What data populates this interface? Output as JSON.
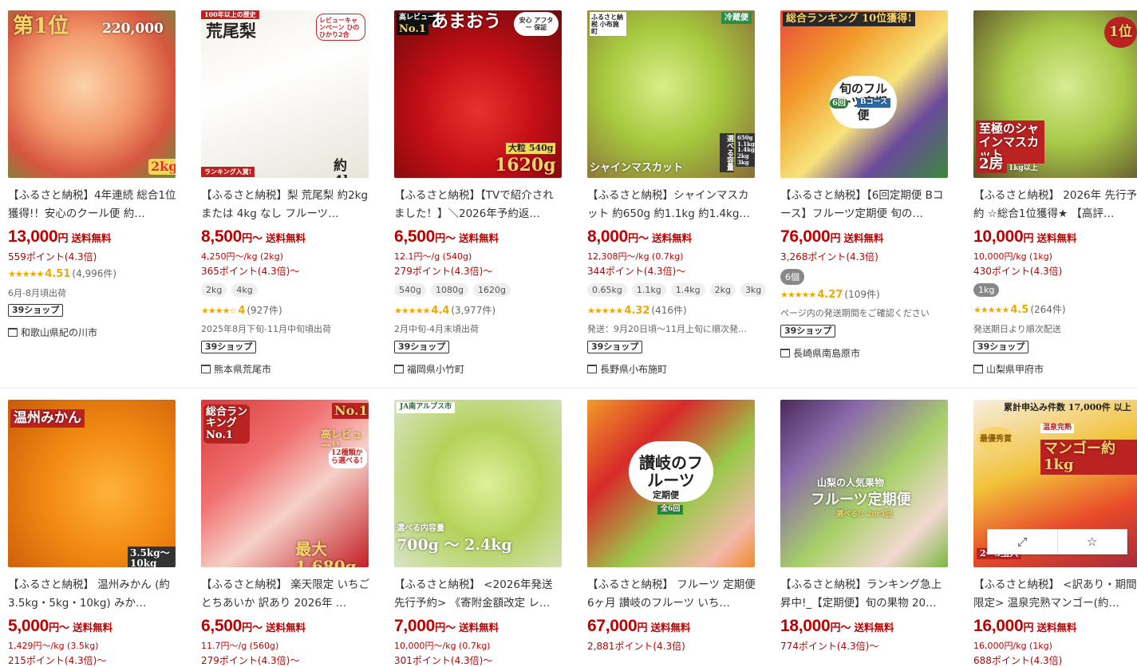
{
  "row1": [
    {
      "image_text": [
        "第1位",
        "220,000",
        "2kg"
      ],
      "title": "【ふるさと納税】4年連続 総合1位獲得!！安心のクール便 約…",
      "price": "13,000",
      "unit": "円",
      "ship": "送料無料",
      "sub1": "559ポイント(4.3倍)",
      "rating": "4.51",
      "reviews": "(4,996件)",
      "note": "6月-8月頃出荷",
      "tag": "39ショップ",
      "location": "和歌山県紀の川市"
    },
    {
      "image_text": [
        "100年以上の歴史",
        "荒尾梨",
        "レビューキャンペーン ひのひかり2合",
        "ランキング入賞!",
        "約4kg"
      ],
      "title": "【ふるさと納税】梨 荒尾梨 約2kg または 4kg なし フルーツ…",
      "price": "8,500",
      "unit": "円〜",
      "ship": "送料無料",
      "sub1": "4,250円〜/kg (2kg)",
      "sub2": "365ポイント(4.3倍)〜",
      "chips": [
        "2kg",
        "4kg"
      ],
      "rating": "4",
      "reviews": "(927件)",
      "note": "2025年8月下旬-11月中旬頃出荷",
      "tag": "39ショップ",
      "location": "熊本県荒尾市"
    },
    {
      "image_text": [
        "高レビュー!",
        "No.1",
        "あまおう",
        "安心 アフター 保証",
        "大粒 540g",
        "1620g"
      ],
      "title": "【ふるさと納税】【TVで紹介されました！】＼2026年予約返…",
      "price": "6,500",
      "unit": "円〜",
      "ship": "送料無料",
      "sub1": "12.1円〜/g (540g)",
      "sub2": "279ポイント(4.3倍)〜",
      "chips": [
        "540g",
        "1080g",
        "1620g"
      ],
      "rating": "4.4",
      "reviews": "(3,977件)",
      "note": "2月中旬-4月末頃出荷",
      "tag": "39ショップ",
      "location": "福岡県小竹町"
    },
    {
      "image_text": [
        "ふるさと納税 小布施町",
        "冷蔵便",
        "シャインマスカット",
        "選べる容量",
        "650g 1.1kg 1.4kg 2kg 3kg"
      ],
      "title": "【ふるさと納税】シャインマスカット 約650g 約1.1kg 約1.4kg…",
      "price": "8,000",
      "unit": "円〜",
      "ship": "送料無料",
      "sub1": "12,308円〜/kg (0.7kg)",
      "sub2": "344ポイント(4.3倍)〜",
      "chips": [
        "0.65kg",
        "1.1kg",
        "1.4kg",
        "2kg",
        "3kg"
      ],
      "rating": "4.32",
      "reviews": "(416件)",
      "note": "発送：9月20日頃〜11月上旬に順次発…",
      "tag": "39ショップ",
      "location": "長野県小布施町"
    },
    {
      "image_text": [
        "総合ランキング 10位獲得!",
        "旬のフルーツ定期便",
        "6回",
        "Bコース"
      ],
      "title": "【ふるさと納税】【6回定期便 Bコース】フルーツ定期便 旬の…",
      "price": "76,000",
      "unit": "円",
      "ship": "送料無料",
      "sub1": "3,268ポイント(4.3倍)",
      "chips_dark": [
        "6個"
      ],
      "rating": "4.27",
      "reviews": "(109件)",
      "note": "ページ内の発送期間をご確認ください",
      "tag": "39ショップ",
      "location": "長崎県南島原市"
    },
    {
      "image_text": [
        "1位",
        "至極のシャインマスカット",
        "2房",
        "1kg以上"
      ],
      "title": "【ふるさと納税】 2026年 先行予約 ☆総合1位獲得★ 【高評…",
      "price": "10,000",
      "unit": "円",
      "ship": "送料無料",
      "sub1": "10,000円/kg (1kg)",
      "sub2": "430ポイント(4.3倍)",
      "chips_dark": [
        "1kg"
      ],
      "rating": "4.5",
      "reviews": "(264件)",
      "note": "発送期日より順次配送",
      "tag": "39ショップ",
      "location": "山梨県甲府市"
    }
  ],
  "row2": [
    {
      "image_text": [
        "温州みかん",
        "3.5kg〜10kg"
      ],
      "title": "【ふるさと納税】 温州みかん (約3.5kg・5kg・10kg) みか…",
      "price": "5,000",
      "unit": "円〜",
      "ship": "送料無料",
      "sub1": "1,429円〜/kg (3.5kg)",
      "sub2": "215ポイント(4.3倍)〜"
    },
    {
      "image_text": [
        "総合ランキング No.1",
        "No.1",
        "高レビュー!!",
        "12種類から選べる!",
        "最大 1,680g"
      ],
      "title": "【ふるさと納税】 楽天限定 いちご とちあいか 訳あり 2026年 …",
      "price": "6,500",
      "unit": "円〜",
      "ship": "送料無料",
      "sub1": "11.7円〜/g (560g)",
      "sub2": "279ポイント(4.3倍)〜"
    },
    {
      "image_text": [
        "JA南アルプス市",
        "選べる内容量",
        "700g 〜 2.4kg"
      ],
      "title": "【ふるさと納税】 <2026年発送 先行予約> 《寄附金額改定 レ…",
      "price": "7,000",
      "unit": "円〜",
      "ship": "送料無料",
      "sub1": "10,000円〜/kg (0.7kg)",
      "sub2": "301ポイント(4.3倍)〜"
    },
    {
      "image_text": [
        "讃岐のフルーツ",
        "定期便",
        "全6回"
      ],
      "title": "【ふるさと納税】 フルーツ 定期便 6ヶ月 讃岐のフルーツ いち…",
      "price": "67,000",
      "unit": "円",
      "ship": "送料無料",
      "sub1": "2,881ポイント(4.3倍)"
    },
    {
      "image_text": [
        "山梨の人気果物",
        "フルーツ定期便",
        "選べる!! 2or3回"
      ],
      "title": "【ふるさと納税】ランキング急上昇中!_【定期便】旬の果物 20…",
      "price": "18,000",
      "unit": "円〜",
      "ship": "送料無料",
      "sub1": "774ポイント(4.3倍)〜"
    },
    {
      "image_text": [
        "累計申込み件数 17,000件 以上",
        "最優秀賞",
        "温泉完熟",
        "マンゴー約1kg",
        "2〜3玉入"
      ],
      "title": "【ふるさと納税】 <訳あり・期間限定> 温泉完熟マンゴー(約…",
      "price": "16,000",
      "unit": "円",
      "ship": "送料無料",
      "sub1": "16,000円/kg (1kg)",
      "sub2": "688ポイント(4.3倍)"
    }
  ],
  "hover_actions": {
    "expand_icon": "expand-icon",
    "favorite_icon": "star-icon"
  },
  "colors": {
    "price": "#bf0000",
    "star": "#f0a800"
  }
}
